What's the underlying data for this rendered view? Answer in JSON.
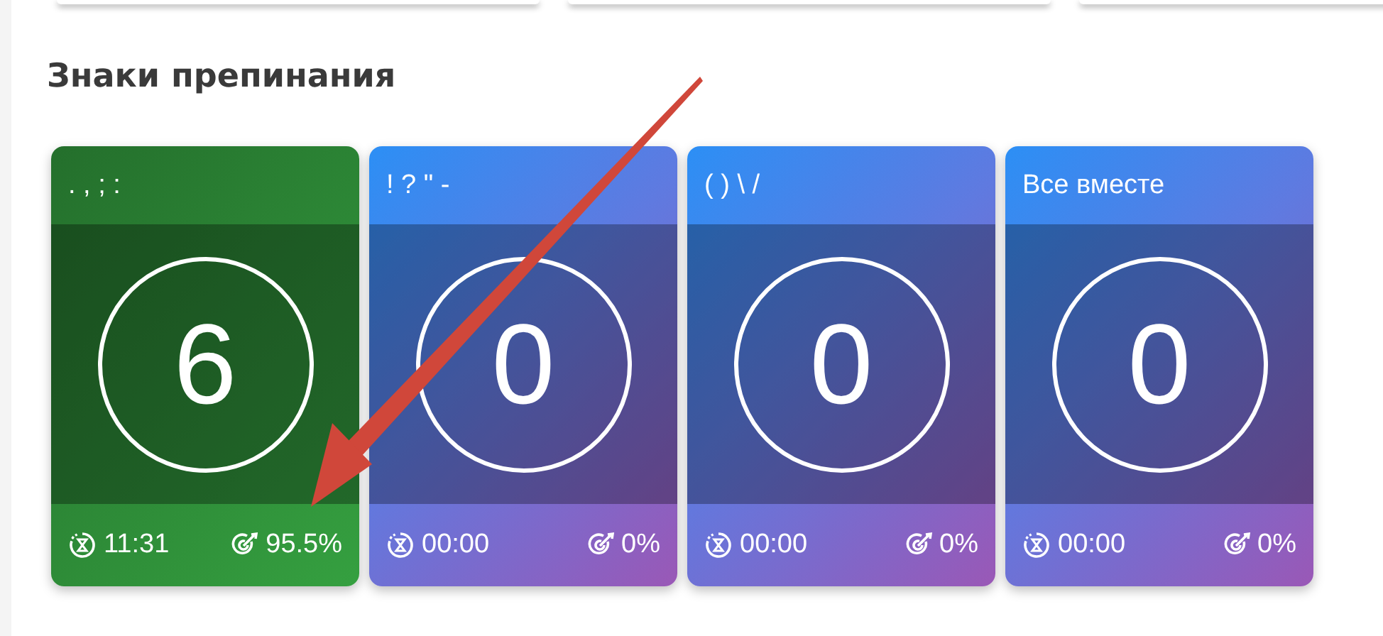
{
  "section": {
    "title": "Знаки препинания"
  },
  "cards": [
    {
      "kind": "done",
      "title": ". , ; :",
      "count": "6",
      "time": "11:31",
      "accuracy": "95.5%"
    },
    {
      "kind": "new",
      "title": "! ? \" -",
      "count": "0",
      "time": "00:00",
      "accuracy": "0%"
    },
    {
      "kind": "new",
      "title": "( ) \\ /",
      "count": "0",
      "time": "00:00",
      "accuracy": "0%"
    },
    {
      "kind": "new",
      "title": "Все вместе",
      "count": "0",
      "time": "00:00",
      "accuracy": "0%"
    }
  ]
}
